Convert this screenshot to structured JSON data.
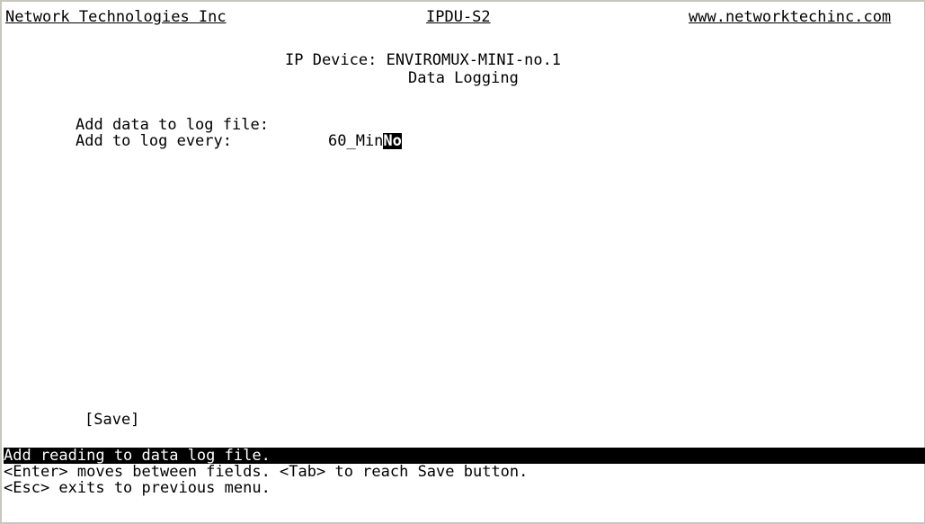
{
  "header": {
    "company": "Network Technologies Inc",
    "product": "IPDU-S2",
    "website": "www.networktechinc.com"
  },
  "title": {
    "device_line": "IP Device: ENVIROMUX-MINI-no.1",
    "section": "Data Logging"
  },
  "fields": {
    "add_to_log_label": "Add data to log file:",
    "add_to_log_value": "No",
    "log_every_label": "Add to log every:",
    "log_every_value": "60_Min"
  },
  "save_label": "[Save]",
  "status": {
    "highlight_text": "Add reading to data log file.",
    "help_line_1": "<Enter> moves between fields. <Tab> to reach Save button.",
    "help_line_2": "<Esc> exits to previous menu."
  }
}
